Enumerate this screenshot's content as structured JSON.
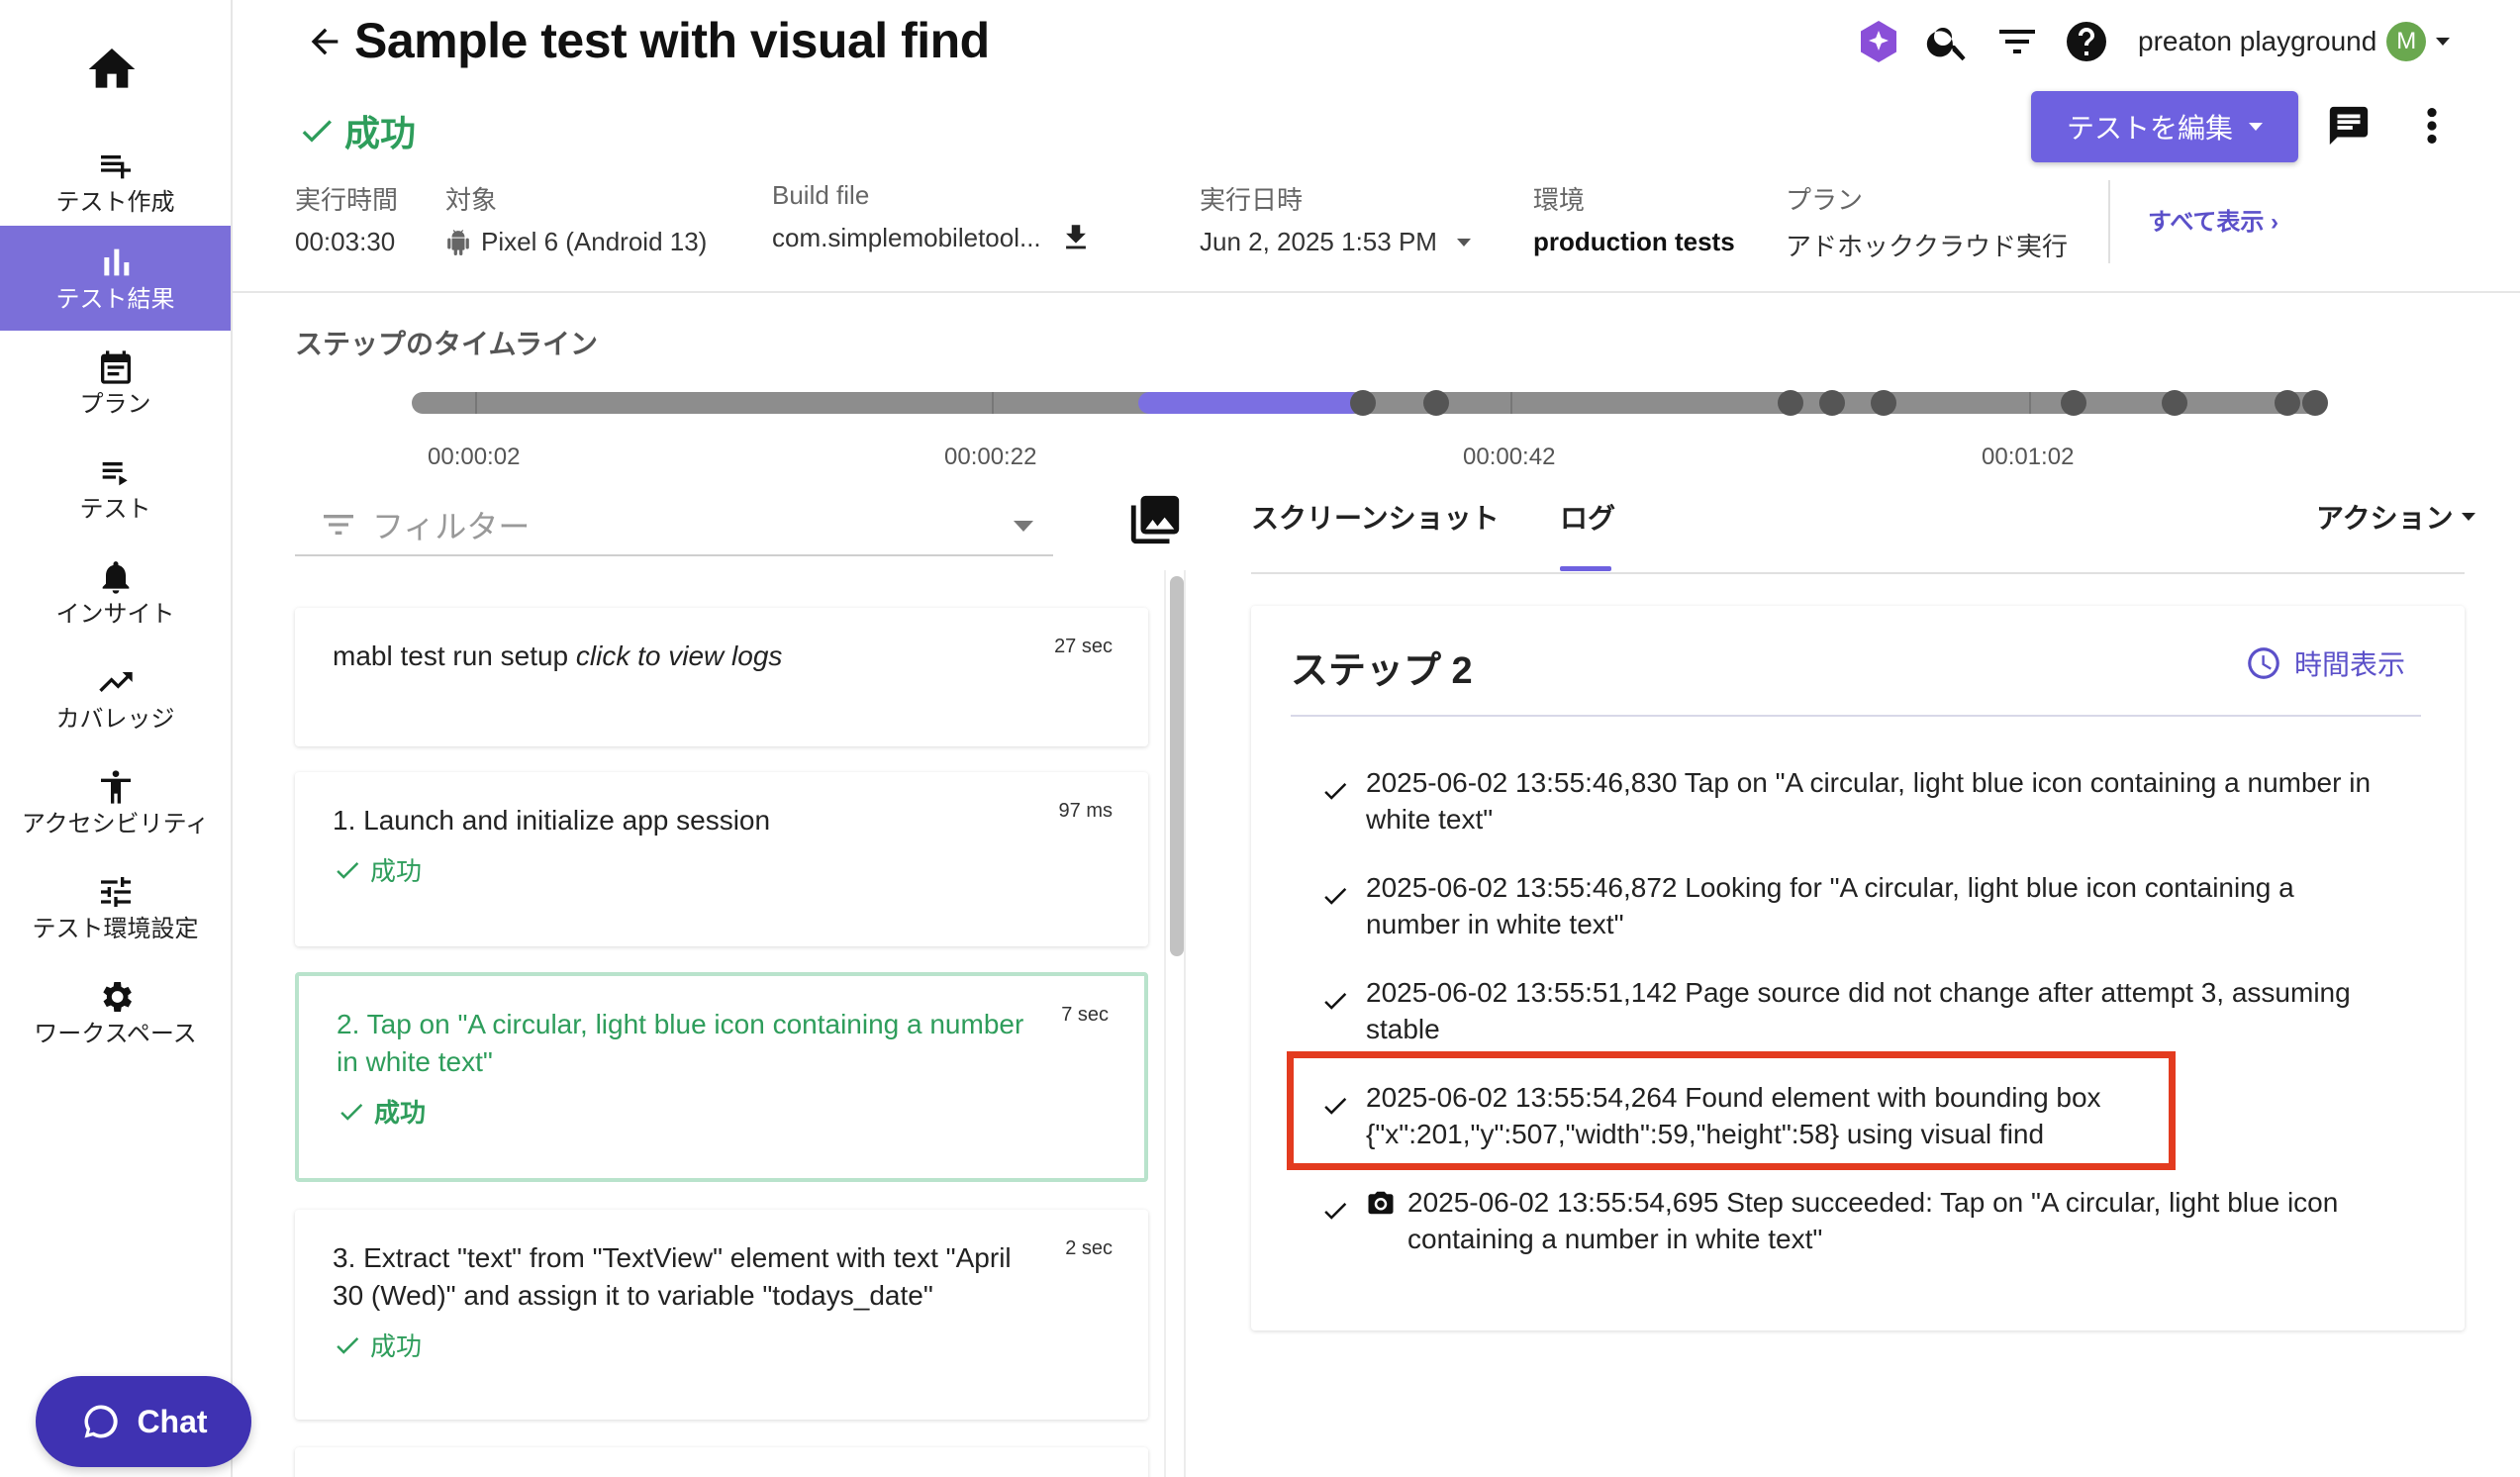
{
  "sidebar": {
    "items": [
      {
        "label": "テスト作成"
      },
      {
        "label": "テスト結果"
      },
      {
        "label": "プラン"
      },
      {
        "label": "テスト"
      },
      {
        "label": "インサイト"
      },
      {
        "label": "カバレッジ"
      },
      {
        "label": "アクセシビリティ"
      },
      {
        "label": "テスト環境設定"
      },
      {
        "label": "ワークスペース"
      }
    ],
    "active_index": 1,
    "chat_label": "Chat"
  },
  "header": {
    "title": "Sample test with visual find",
    "status": "成功",
    "account_name": "preaton playground",
    "avatar_initial": "M",
    "edit_button": "テストを編集",
    "accent_color": "#6e61e0",
    "success_color": "#2e9d5b"
  },
  "meta": {
    "duration_label": "実行時間",
    "duration_value": "00:03:30",
    "target_label": "対象",
    "target_value": "Pixel 6 (Android 13)",
    "build_label": "Build file",
    "build_value": "com.simplemobiletool...",
    "run_date_label": "実行日時",
    "run_date_value": "Jun 2, 2025 1:53 PM",
    "env_label": "環境",
    "env_value": "production tests",
    "plan_label": "プラン",
    "plan_value": "アドホッククラウド実行",
    "show_all": "すべて表示 ›"
  },
  "timeline": {
    "title": "ステップのタイムライン",
    "tick_labels": [
      "00:00:02",
      "00:00:22",
      "00:00:42",
      "00:01:02"
    ]
  },
  "filter": {
    "placeholder": "フィルター"
  },
  "steps": [
    {
      "title": "mabl test run setup",
      "title_italic": "click to view logs",
      "duration": "27 sec"
    },
    {
      "title": "1. Launch and initialize app session",
      "duration": "97 ms",
      "status": "成功"
    },
    {
      "title": "2. Tap on \"A circular, light blue icon containing a number in white text\"",
      "duration": "7 sec",
      "status": "成功"
    },
    {
      "title": "3. Extract \"text\" from \"TextView\" element with text \"April 30 (Wed)\" and assign it to variable \"todays_date\"",
      "duration": "2 sec",
      "status": "成功"
    }
  ],
  "tabs": {
    "screenshot": "スクリーンショット",
    "log": "ログ",
    "actions": "アクション"
  },
  "log": {
    "heading": "ステップ 2",
    "time_toggle": "時間表示",
    "entries": [
      "2025-06-02 13:55:46,830 Tap on \"A circular, light blue icon containing a number in white text\"",
      "2025-06-02 13:55:46,872 Looking for \"A circular, light blue icon containing a number in white text\"",
      "2025-06-02 13:55:51,142 Page source did not change after attempt 3, assuming stable",
      "2025-06-02 13:55:54,264 Found element with bounding box {\"x\":201,\"y\":507,\"width\":59,\"height\":58} using visual find",
      "2025-06-02 13:55:54,695 Step succeeded: Tap on \"A circular, light blue icon containing a number in white text\""
    ]
  }
}
